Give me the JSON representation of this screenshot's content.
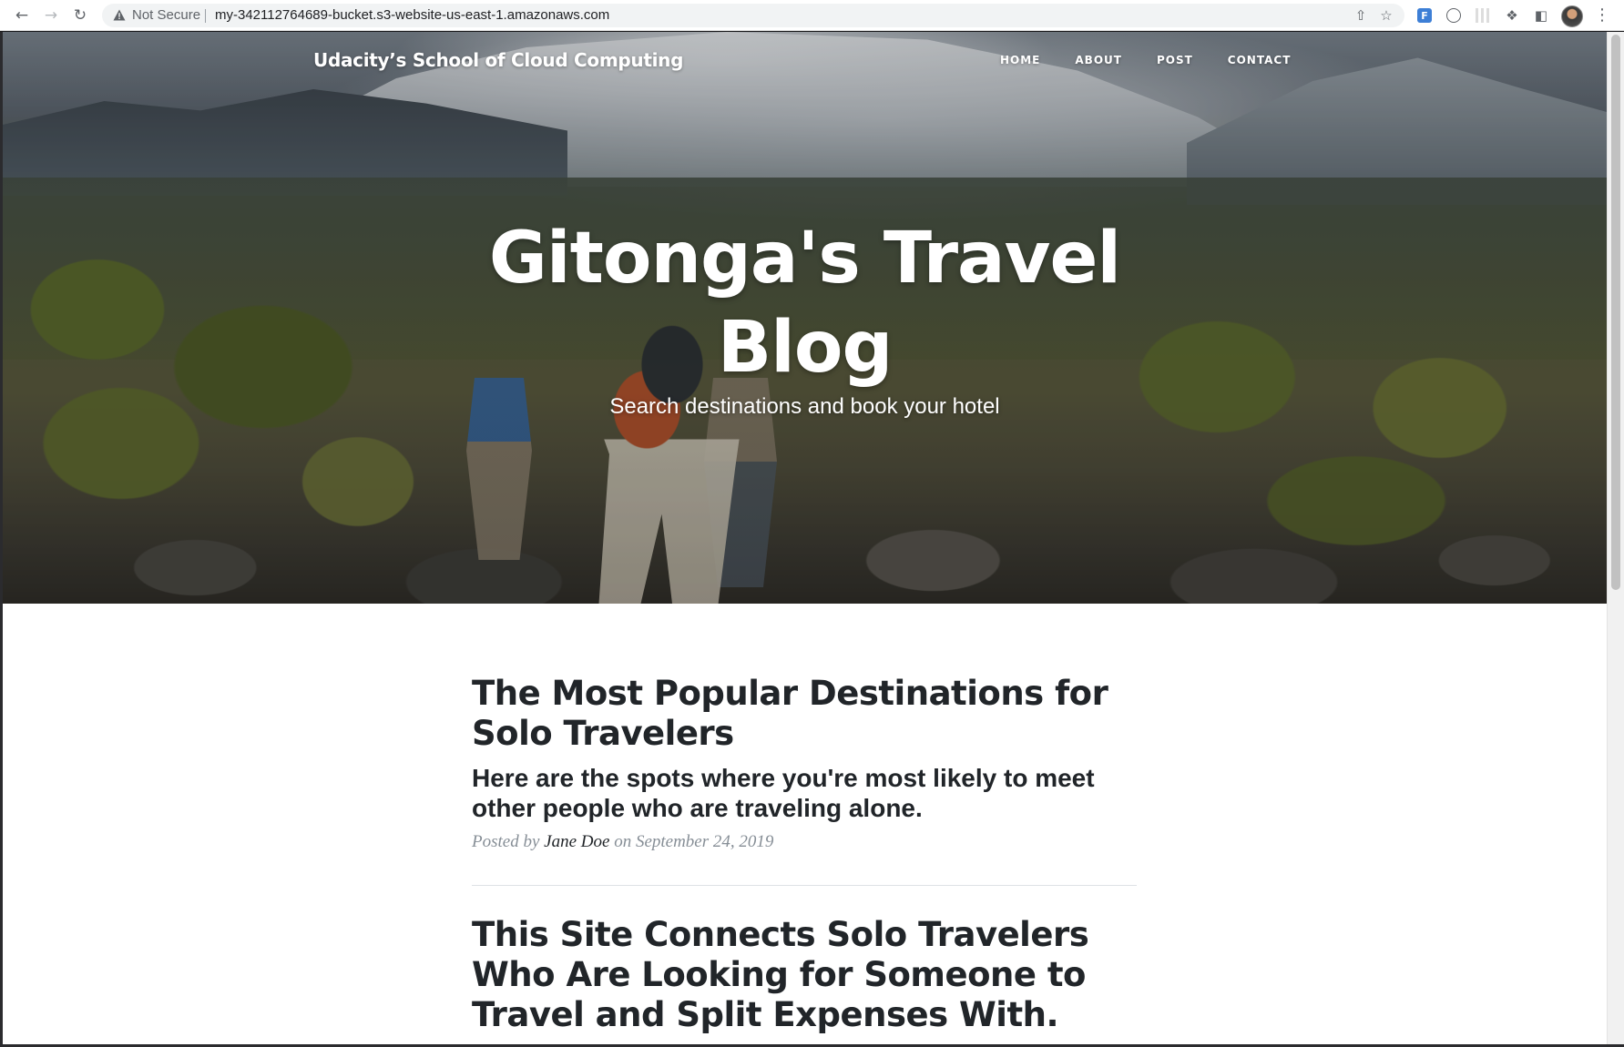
{
  "browser": {
    "security_label": "Not Secure",
    "url": "my-342112764689-bucket.s3-website-us-east-1.amazonaws.com",
    "icons": [
      "back-arrow-icon",
      "forward-arrow-icon",
      "reload-icon",
      "warning-icon",
      "share-icon",
      "star-icon",
      "extension-icons",
      "puzzle-icon",
      "side-panel-icon",
      "profile-avatar",
      "menu-dots-icon"
    ],
    "ext_letter": "F",
    "ext_circle": "(·)"
  },
  "site": {
    "brand": "Udacity’s School of Cloud Computing",
    "nav": [
      {
        "label": "HOME"
      },
      {
        "label": "ABOUT"
      },
      {
        "label": "POST"
      },
      {
        "label": "CONTACT"
      }
    ]
  },
  "hero": {
    "title_line1": "Gitonga's Travel",
    "title_line2": "Blog",
    "subtitle": "Search destinations and book your hotel"
  },
  "posts": [
    {
      "title": "The Most Popular Destinations for Solo Travelers",
      "subtitle": "Here are the spots where you're most likely to meet other people who are traveling alone.",
      "meta_prefix": "Posted by ",
      "author": "Jane Doe",
      "meta_suffix": " on September 24, 2019"
    },
    {
      "title": "This Site Connects Solo Travelers Who Are Looking for Someone to Travel and Split Expenses With."
    }
  ]
}
